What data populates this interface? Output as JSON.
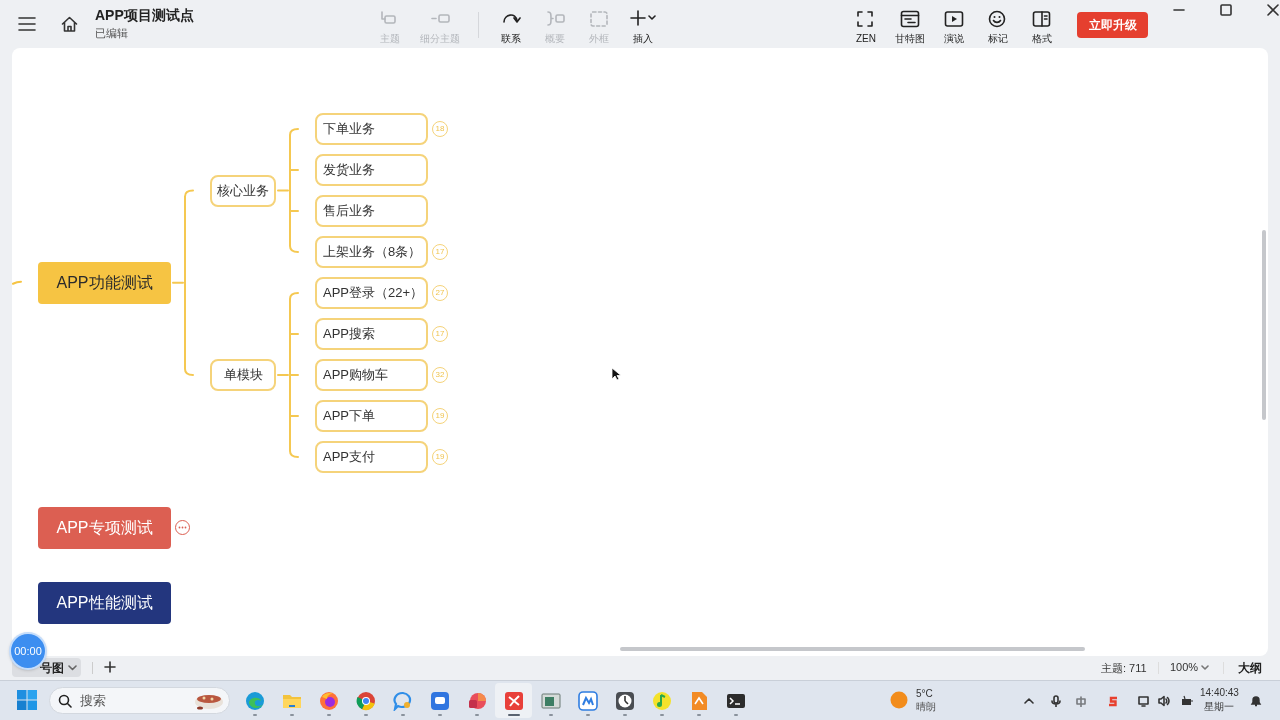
{
  "window": {
    "title": "APP项目测试点",
    "subtitle": "已编辑"
  },
  "toolbar": [
    {
      "kind": "topic",
      "label": "主题",
      "disabled": true
    },
    {
      "kind": "subtopic",
      "label": "细分主题",
      "disabled": true
    },
    {
      "kind": "relation",
      "label": "联系",
      "disabled": false
    },
    {
      "kind": "summary",
      "label": "概要",
      "disabled": true
    },
    {
      "kind": "boundary",
      "label": "外框",
      "disabled": true
    },
    {
      "kind": "insert",
      "label": "插入",
      "disabled": false
    }
  ],
  "view_tools": [
    {
      "kind": "zen",
      "label": "ZEN"
    },
    {
      "kind": "gantt",
      "label": "甘特图"
    },
    {
      "kind": "present",
      "label": "演说"
    },
    {
      "kind": "marker",
      "label": "标记"
    },
    {
      "kind": "format",
      "label": "格式"
    }
  ],
  "upgrade_button": "立即升级",
  "mindmap": {
    "roots": [
      {
        "label": "APP功能测试",
        "color": "#f6c443",
        "collapsed": false,
        "children": [
          {
            "label": "核心业务",
            "children": [
              {
                "label": "下单业务",
                "count": "18"
              },
              {
                "label": "发货业务"
              },
              {
                "label": "售后业务"
              },
              {
                "label": "上架业务（8条）",
                "count": "17"
              }
            ]
          },
          {
            "label": "单模块",
            "children": [
              {
                "label": "APP登录（22+）",
                "count": "27"
              },
              {
                "label": "APP搜索",
                "count": "17"
              },
              {
                "label": "APP购物车",
                "count": "32"
              },
              {
                "label": "APP下单",
                "count": "19"
              },
              {
                "label": "APP支付",
                "count": "19"
              }
            ]
          }
        ]
      },
      {
        "label": "APP专项测试",
        "color": "#dc5f52",
        "collapsed": true
      },
      {
        "label": "APP性能测试",
        "color": "#23367e",
        "collapsed": false
      }
    ]
  },
  "timer": "00:00",
  "sheet_tab": {
    "label": "号图"
  },
  "status_bar": {
    "topics": "主题: 711",
    "zoom": "100%",
    "outline": "大纲"
  },
  "taskbar": {
    "search_placeholder": "搜索",
    "apps": [
      {
        "kind": "edge",
        "selected": false
      },
      {
        "kind": "folder",
        "selected": false
      },
      {
        "kind": "firefox",
        "selected": false
      },
      {
        "kind": "chrome",
        "selected": false
      },
      {
        "kind": "chat",
        "selected": false
      },
      {
        "kind": "meeting",
        "selected": false
      },
      {
        "kind": "slides",
        "selected": false
      },
      {
        "kind": "xmind",
        "selected": true
      },
      {
        "kind": "window",
        "selected": false
      },
      {
        "kind": "mark",
        "selected": false
      },
      {
        "kind": "clock",
        "selected": false
      },
      {
        "kind": "music",
        "selected": false
      },
      {
        "kind": "pdf",
        "selected": false
      },
      {
        "kind": "terminal",
        "selected": false
      }
    ],
    "weather": {
      "temp": "5°C",
      "text": "晴朗"
    },
    "time": "14:40:43",
    "day": "星期一"
  }
}
